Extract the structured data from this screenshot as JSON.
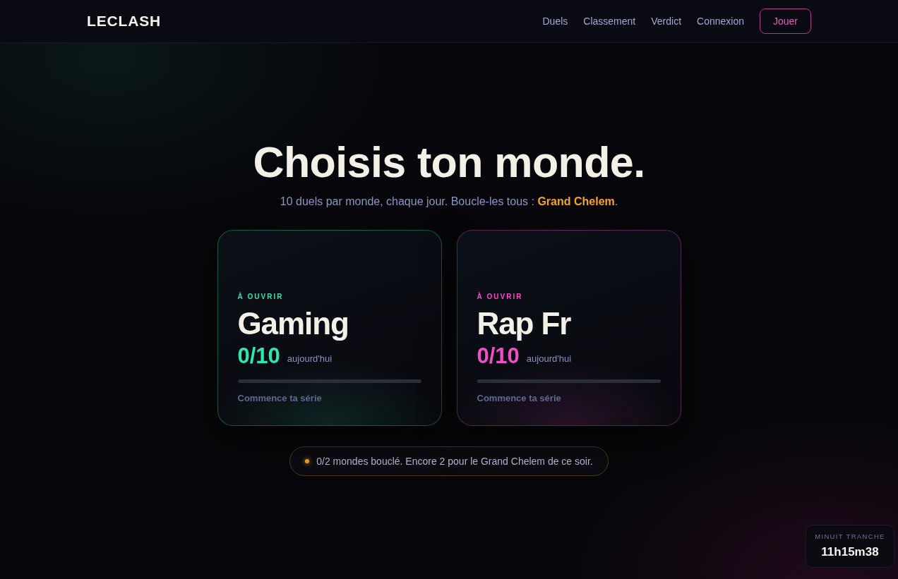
{
  "header": {
    "logo": "LECLASH",
    "nav": [
      "Duels",
      "Classement",
      "Verdict",
      "Connexion"
    ],
    "cta": "Jouer"
  },
  "hero": {
    "title": "Choisis ton monde.",
    "subtitle": "10 duels par monde, chaque jour. Boucle-les tous : **Grand Chelem**."
  },
  "worlds": [
    {
      "status": "À OUVRIR",
      "name": "Gaming",
      "score": "0/10",
      "score_label": "aujourd'hui",
      "hint": "Commence ta série",
      "color": "#2ee6b0"
    },
    {
      "status": "À OUVRIR",
      "name": "Rap Fr",
      "score": "0/10",
      "score_label": "aujourd'hui",
      "hint": "Commence ta série",
      "color": "#f04fc8"
    }
  ],
  "progress_notice": {
    "text": "0/2 mondes bouclé. Encore 2 pour le Grand Chelem de ce soir."
  },
  "countdown": {
    "label": "MINUIT TRANCHE",
    "value": "11h15m38"
  }
}
